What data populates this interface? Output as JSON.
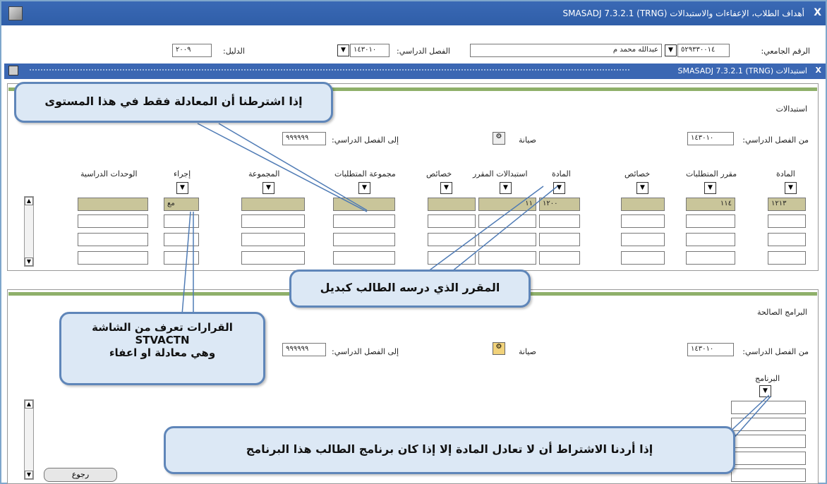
{
  "window": {
    "title": "أهداف الطلاب، الإعفاءات والاستبدالات (SMASADJ 7.3.2.1 (TRNG",
    "close": "X"
  },
  "key_block": {
    "student_id_label": "الرقم الجامعي:",
    "student_id_value": "٥٢٩٣٣٠٠١٤",
    "student_name": "عبدالله محمد م",
    "term_label": "الفصل الدراسي:",
    "term_value": "١٤٣٠١٠",
    "catalog_label": "الدليل:",
    "catalog_value": "٢٠٠٩"
  },
  "sub_window": {
    "title": "استبدالات (SMASADJ 7.3.2.1 (TRNG"
  },
  "substitutions": {
    "heading": "استبدالات",
    "from_term_label": "من الفصل الدراسي:",
    "from_term_value": "١٤٣٠١٠",
    "maintenance_label": "صيانة",
    "to_term_label": "إلى الفصل الدراسي:",
    "to_term_value": "٩٩٩٩٩٩",
    "columns": {
      "subject": "المادة",
      "requirement_course": "مقرر المتطلبات",
      "attributes_1": "خصائص",
      "subject_2": "المادة",
      "course_substitutions": "استبدالات المقرر",
      "attributes_2": "خصائص",
      "requirement_group": "مجموعة المتطلبات",
      "group": "المجموعة",
      "action": "إجراء",
      "credits": "الوحدات الدراسية"
    },
    "row1": {
      "subject": "١٢١٣",
      "course": "١١٤",
      "subject_2": "١٢٠٠",
      "course_sub": "١١",
      "action": "مع"
    }
  },
  "programs": {
    "heading": "البرامج الصالحة",
    "from_term_label": "من الفصل الدراسي:",
    "from_term_value": "١٤٣٠١٠",
    "maintenance_label": "صيانة",
    "to_term_label": "إلى الفصل الدراسي:",
    "to_term_value": "٩٩٩٩٩٩",
    "program_label": "البرنامج"
  },
  "return_button": "رجوع",
  "callouts": {
    "c1": "إذا اشترطنا أن المعادلة فقط في هذا المستوى",
    "c2": "المقرر الذي درسه الطالب كبديل",
    "c3_line1": "القرارات تعرف من الشاشة",
    "c3_line2": "STVACTN",
    "c3_line3": "وهي معادلة او اعفاء",
    "c4": "إذا أردنا الاشتراط أن لا تعادل المادة إلا إذا كان برنامج الطالب هذا البرنامج"
  },
  "icons": [
    "app-icon",
    "close-icon",
    "dropdown-icon",
    "maintenance-icon",
    "scroll-up-icon",
    "scroll-down-icon"
  ],
  "colors": {
    "titlebar": "#2f5ea8",
    "callout_fill": "#dce8f5",
    "callout_border": "#5f86b9",
    "tan_field": "#c9c59a",
    "green_rule": "#8fb06a"
  }
}
